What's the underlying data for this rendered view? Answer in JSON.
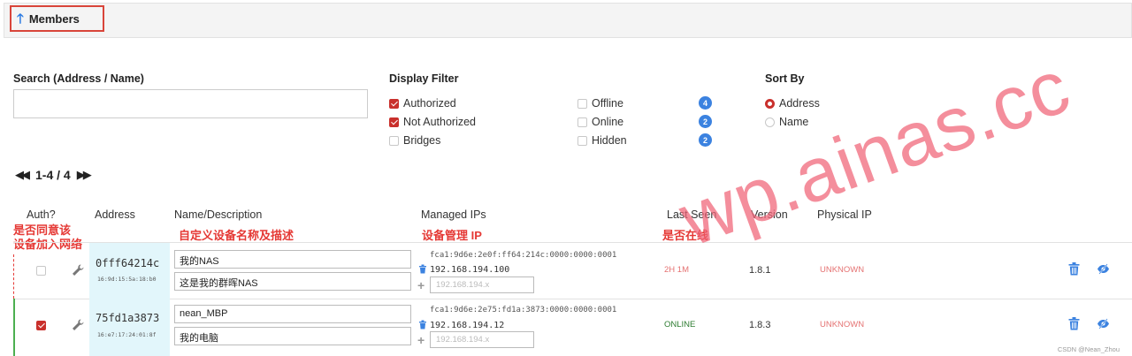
{
  "header": {
    "title": "Members"
  },
  "search": {
    "label": "Search (Address / Name)",
    "value": "",
    "placeholder": ""
  },
  "display_filter": {
    "label": "Display Filter",
    "items": [
      {
        "label": "Authorized",
        "checked": true
      },
      {
        "label": "Not Authorized",
        "checked": true
      },
      {
        "label": "Bridges",
        "checked": false
      },
      {
        "label": "Offline",
        "checked": false,
        "count": "4"
      },
      {
        "label": "Online",
        "checked": false,
        "count": "2"
      },
      {
        "label": "Hidden",
        "checked": false,
        "count": "2"
      }
    ]
  },
  "sort_by": {
    "label": "Sort By",
    "options": [
      {
        "label": "Address",
        "selected": true
      },
      {
        "label": "Name",
        "selected": false
      }
    ]
  },
  "pager": {
    "range": "1-4 / 4"
  },
  "columns": {
    "auth": "Auth?",
    "address": "Address",
    "name": "Name/Description",
    "ips": "Managed IPs",
    "last_seen": "Last Seen",
    "version": "Version",
    "physical": "Physical IP"
  },
  "annotations": {
    "auth": [
      "是否同意该",
      "设备加入网络"
    ],
    "name": "自定义设备名称及描述",
    "ips": "设备管理 IP",
    "last_seen": "是否在线"
  },
  "members": [
    {
      "authorized": false,
      "address": "0fff64214c",
      "mac": "16:9d:15:5a:18:b0",
      "name": "我的NAS",
      "description": "这是我的群晖NAS",
      "ipv6": "fca1:9d6e:2e0f:ff64:214c:0000:0000:0001",
      "ipv4": "192.168.194.100",
      "ip_placeholder": "192.168.194.x",
      "last_seen": "2H 1M",
      "version": "1.8.1",
      "physical_ip": "UNKNOWN"
    },
    {
      "authorized": true,
      "address": "75fd1a3873",
      "mac": "16:e7:17:24:01:8f",
      "name": "nean_MBP",
      "description": "我的电脑",
      "ipv6": "fca1:9d6e:2e75:fd1a:3873:0000:0000:0001",
      "ipv4": "192.168.194.12",
      "ip_placeholder": "192.168.194.x",
      "last_seen": "ONLINE",
      "version": "1.8.3",
      "physical_ip": "UNKNOWN"
    }
  ],
  "colors": {
    "accent_red": "#c9302c",
    "badge_blue": "#3b82e0",
    "online_green": "#2e7d32",
    "offline_salmon": "#e57373",
    "annotation_red": "#e53935"
  },
  "watermark": "wp.ainas.cc",
  "footer": {
    "credit": "CSDN @Nean_Zhou"
  }
}
